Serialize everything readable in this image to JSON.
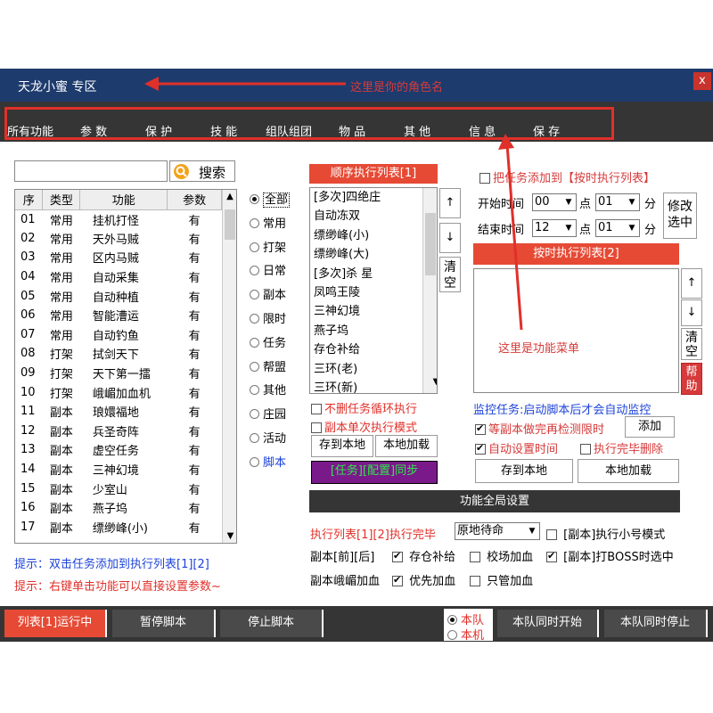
{
  "title": "天龙小蜜 专区",
  "close": "x",
  "annotations": {
    "role_name": "这里是你的角色名",
    "function_menu": "这里是功能菜单"
  },
  "menu": [
    "所有功能",
    "参 数",
    "保 护",
    "技 能",
    "组队组团",
    "物 品",
    "其 他",
    "信 息",
    "保 存"
  ],
  "search": {
    "value": "",
    "button": "搜索"
  },
  "table": {
    "headers": [
      "序",
      "类型",
      "功能",
      "参数"
    ],
    "rows": [
      [
        "01",
        "常用",
        "挂机打怪",
        "有"
      ],
      [
        "02",
        "常用",
        "天外马贼",
        "有"
      ],
      [
        "03",
        "常用",
        "区内马贼",
        "有"
      ],
      [
        "04",
        "常用",
        "自动采集",
        "有"
      ],
      [
        "05",
        "常用",
        "自动种植",
        "有"
      ],
      [
        "06",
        "常用",
        "智能漕运",
        "有"
      ],
      [
        "07",
        "常用",
        "自动钓鱼",
        "有"
      ],
      [
        "08",
        "打架",
        "拭剑天下",
        "有"
      ],
      [
        "09",
        "打架",
        "天下第一擂",
        "有"
      ],
      [
        "10",
        "打架",
        "峨嵋加血机",
        "有"
      ],
      [
        "11",
        "副本",
        "琅嬛福地",
        "有"
      ],
      [
        "12",
        "副本",
        "兵圣奇阵",
        "有"
      ],
      [
        "13",
        "副本",
        "虚空任务",
        "有"
      ],
      [
        "14",
        "副本",
        "三神幻境",
        "有"
      ],
      [
        "15",
        "副本",
        "少室山",
        "有"
      ],
      [
        "16",
        "副本",
        "燕子坞",
        "有"
      ],
      [
        "17",
        "副本",
        "缥缈峰(小)",
        "有"
      ]
    ]
  },
  "radios": [
    "全部",
    "常用",
    "打架",
    "日常",
    "副本",
    "限时",
    "任务",
    "帮盟",
    "其他",
    "庄园",
    "活动",
    "脚本"
  ],
  "seq_list": {
    "header": "顺序执行列表[1]",
    "items": [
      "[多次]四绝庄",
      "自动冻双",
      "缥缈峰(小)",
      "缥缈峰(大)",
      "[多次]杀   星",
      "凤鸣王陵",
      "三神幻境",
      "燕子坞",
      "存仓补给",
      "三环(老)",
      "三环(新)"
    ],
    "up": "↑",
    "down": "↓",
    "clear": "清空"
  },
  "seq_options": {
    "no_delete_loop": "不删任务循环执行",
    "single_mode": "副本单次执行模式",
    "save_local": "存到本地",
    "load_local": "本地加载",
    "sync": "[任务][配置]同步"
  },
  "timed": {
    "add_to": "把任务添加到【按时执行列表】",
    "start_label": "开始时间",
    "end_label": "结束时间",
    "start_h": "00",
    "start_m": "01",
    "end_h": "12",
    "end_m": "01",
    "point": "点",
    "minute": "分",
    "modify": "修改选中",
    "header": "按时执行列表[2]",
    "up": "↑",
    "down": "↓",
    "clear": "清空",
    "help": "帮助"
  },
  "monitor": {
    "label": "监控任务:启动脚本后才会自动监控",
    "wait_check": "等副本做完再检测限时",
    "add": "添加",
    "auto_time": "自动设置时间",
    "delete_done": "执行完毕删除",
    "save_local": "存到本地",
    "load_local": "本地加载"
  },
  "hints": {
    "h1": "提示：双击任务添加到执行列表[1][2]",
    "h2": "提示：右键单击功能可以直接设置参数~"
  },
  "global": {
    "header": "功能全局设置",
    "after_done_label": "执行列表[1][2]执行完毕",
    "after_done_value": "原地待命",
    "small_mode": "[副本]执行小号模式",
    "fb_before_after": "副本[前][后]",
    "store_supply": "存仓补给",
    "school_heal": "校场加血",
    "boss_heal": "[副本]打BOSS时选中",
    "emei_heal": "副本峨嵋加血",
    "priority_heal": "优先加血",
    "only_heal": "只管加血"
  },
  "bottom": {
    "run_list": "列表[1]运行中",
    "pause": "暂停脚本",
    "stop": "停止脚本",
    "team": "本队",
    "local": "本机",
    "team_start": "本队同时开始",
    "team_stop": "本队同时停止"
  },
  "colors": {
    "titlebar": "#1e3b6e",
    "menubar": "#353535",
    "accent_red": "#e64a35",
    "annot": "#d63a3a",
    "purple": "#7a1a8a",
    "hint_blue": "#1d43d8"
  }
}
